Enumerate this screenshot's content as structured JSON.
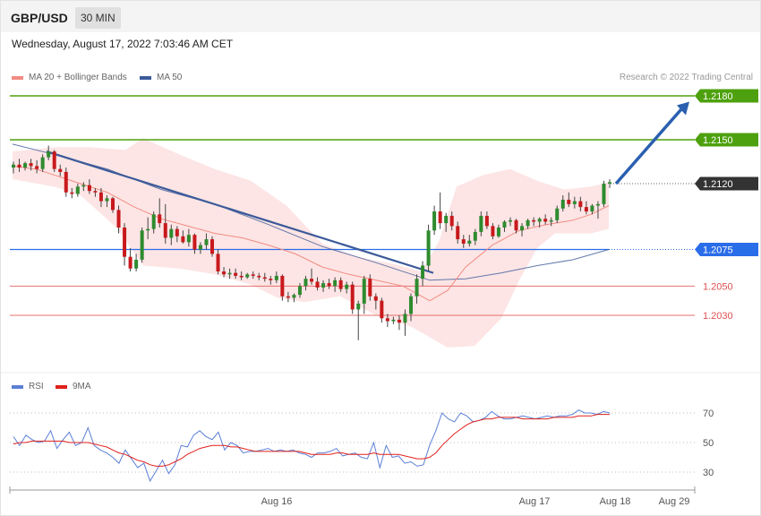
{
  "header": {
    "symbol": "GBP/USD",
    "interval": "30 MIN"
  },
  "timestamp": "Wednesday, August 17, 2022 7:03:46 AM CET",
  "legend": [
    {
      "label": "MA 20 + Bollinger Bands",
      "color": "#f28b82"
    },
    {
      "label": "MA 50",
      "color": "#3b5a99"
    }
  ],
  "credit": "Research © 2022 Trading Central",
  "rsi_legend": [
    {
      "label": "RSI",
      "color": "#5b7fd6"
    },
    {
      "label": "9MA",
      "color": "#e0201b"
    }
  ],
  "chart_data": {
    "type": "candlestick",
    "pair": "GBP/USD",
    "y_range": [
      2.2028,
      1.2197
    ],
    "levels": [
      {
        "value": 1.218,
        "label": "1.2180",
        "color": "#4ea10e",
        "style": "resistance"
      },
      {
        "value": 1.215,
        "label": "1.2150",
        "color": "#4ea10e",
        "style": "resistance"
      },
      {
        "value": 1.212,
        "label": "1.2120",
        "color": "#333333",
        "style": "last"
      },
      {
        "value": 1.2075,
        "label": "1.2075",
        "color": "#2a6de8",
        "style": "pivot"
      },
      {
        "value": 1.205,
        "label": "1.2050",
        "color": "#e05050",
        "style": "support"
      },
      {
        "value": 1.203,
        "label": "1.2030",
        "color": "#e05050",
        "style": "support"
      }
    ],
    "x_labels": [
      "Aug 16",
      "Aug 17",
      "Aug 18",
      "Aug 29"
    ],
    "candles": [
      [
        1.2131,
        1.2135,
        1.2127,
        1.2133
      ],
      [
        1.2133,
        1.2137,
        1.2128,
        1.2131
      ],
      [
        1.2131,
        1.2135,
        1.2129,
        1.2134
      ],
      [
        1.2134,
        1.2137,
        1.2129,
        1.2132
      ],
      [
        1.2132,
        1.2136,
        1.2127,
        1.213
      ],
      [
        1.213,
        1.214,
        1.2128,
        1.2138
      ],
      [
        1.2138,
        1.2146,
        1.2136,
        1.2142
      ],
      [
        1.2142,
        1.2143,
        1.2128,
        1.213
      ],
      [
        1.213,
        1.2133,
        1.2125,
        1.2128
      ],
      [
        1.2128,
        1.2131,
        1.2111,
        1.2114
      ],
      [
        1.2114,
        1.2117,
        1.211,
        1.2113
      ],
      [
        1.2113,
        1.212,
        1.2111,
        1.2118
      ],
      [
        1.2118,
        1.2121,
        1.2115,
        1.2119
      ],
      [
        1.2119,
        1.2123,
        1.2113,
        1.2115
      ],
      [
        1.2115,
        1.2117,
        1.2111,
        1.2114
      ],
      [
        1.2114,
        1.2117,
        1.2104,
        1.2108
      ],
      [
        1.2108,
        1.2112,
        1.2104,
        1.211
      ],
      [
        1.211,
        1.2111,
        1.21,
        1.2102
      ],
      [
        1.2102,
        1.2105,
        1.2086,
        1.209
      ],
      [
        1.209,
        1.2093,
        1.2064,
        1.207
      ],
      [
        1.207,
        1.2076,
        1.206,
        1.2062
      ],
      [
        1.2062,
        1.2072,
        1.206,
        1.2068
      ],
      [
        1.2068,
        1.209,
        1.2066,
        1.2088
      ],
      [
        1.2088,
        1.2097,
        1.2082,
        1.2089
      ],
      [
        1.2089,
        1.2101,
        1.2086,
        1.2099
      ],
      [
        1.2099,
        1.211,
        1.209,
        1.2093
      ],
      [
        1.2093,
        1.2106,
        1.2079,
        1.2083
      ],
      [
        1.2083,
        1.2092,
        1.2078,
        1.2089
      ],
      [
        1.2089,
        1.2091,
        1.208,
        1.2084
      ],
      [
        1.2084,
        1.2088,
        1.2079,
        1.208
      ],
      [
        1.208,
        1.2089,
        1.2077,
        1.2085
      ],
      [
        1.2085,
        1.2086,
        1.2072,
        1.2075
      ],
      [
        1.2075,
        1.208,
        1.2072,
        1.2078
      ],
      [
        1.2078,
        1.2086,
        1.2075,
        1.2082
      ],
      [
        1.2082,
        1.2084,
        1.207,
        1.2072
      ],
      [
        1.2072,
        1.2075,
        1.2058,
        1.206
      ],
      [
        1.206,
        1.2063,
        1.2056,
        1.2058
      ],
      [
        1.2058,
        1.2062,
        1.2055,
        1.2059
      ],
      [
        1.2059,
        1.2062,
        1.2055,
        1.2057
      ],
      [
        1.2057,
        1.206,
        1.2054,
        1.2056
      ],
      [
        1.2056,
        1.2059,
        1.2055,
        1.2058
      ],
      [
        1.2058,
        1.206,
        1.2055,
        1.2057
      ],
      [
        1.2057,
        1.2059,
        1.2054,
        1.2056
      ],
      [
        1.2056,
        1.2059,
        1.2053,
        1.2055
      ],
      [
        1.2055,
        1.2057,
        1.2051,
        1.2054
      ],
      [
        1.2054,
        1.206,
        1.2052,
        1.2057
      ],
      [
        1.2057,
        1.2058,
        1.204,
        1.2043
      ],
      [
        1.2043,
        1.2046,
        1.2039,
        1.2042
      ],
      [
        1.2042,
        1.2045,
        1.2039,
        1.2044
      ],
      [
        1.2044,
        1.2052,
        1.2042,
        1.205
      ],
      [
        1.205,
        1.2057,
        1.2047,
        1.2055
      ],
      [
        1.2055,
        1.2062,
        1.2051,
        1.2053
      ],
      [
        1.2053,
        1.2056,
        1.2047,
        1.2049
      ],
      [
        1.2049,
        1.2054,
        1.2046,
        1.2052
      ],
      [
        1.2052,
        1.2055,
        1.2048,
        1.205
      ],
      [
        1.205,
        1.2056,
        1.2046,
        1.2054
      ],
      [
        1.2054,
        1.2056,
        1.2046,
        1.2048
      ],
      [
        1.2048,
        1.2053,
        1.2045,
        1.2051
      ],
      [
        1.2051,
        1.2053,
        1.2031,
        1.2034
      ],
      [
        1.2034,
        1.204,
        1.2013,
        1.2038
      ],
      [
        1.2038,
        1.2057,
        1.2031,
        1.2055
      ],
      [
        1.2055,
        1.2058,
        1.204,
        1.2043
      ],
      [
        1.2043,
        1.2045,
        1.2034,
        1.204
      ],
      [
        1.204,
        1.2042,
        1.2025,
        1.2028
      ],
      [
        1.2028,
        1.2031,
        1.2022,
        1.2026
      ],
      [
        1.2026,
        1.2029,
        1.2024,
        1.2027
      ],
      [
        1.2027,
        1.203,
        1.202,
        1.2025
      ],
      [
        1.2025,
        1.2034,
        1.2016,
        1.2031
      ],
      [
        1.2031,
        1.2045,
        1.2026,
        1.2043
      ],
      [
        1.2043,
        1.2058,
        1.2038,
        1.2055
      ],
      [
        1.2055,
        1.2067,
        1.205,
        1.2064
      ],
      [
        1.2064,
        1.2092,
        1.206,
        1.2088
      ],
      [
        1.2088,
        1.2105,
        1.2085,
        1.2101
      ],
      [
        1.2101,
        1.2114,
        1.2089,
        1.2093
      ],
      [
        1.2093,
        1.21,
        1.2087,
        1.2098
      ],
      [
        1.2098,
        1.2101,
        1.2088,
        1.2091
      ],
      [
        1.2091,
        1.2094,
        1.2079,
        1.2082
      ],
      [
        1.2082,
        1.2085,
        1.2076,
        1.2079
      ],
      [
        1.2079,
        1.2085,
        1.2077,
        1.2081
      ],
      [
        1.2081,
        1.2089,
        1.2078,
        1.2087
      ],
      [
        1.2087,
        1.2101,
        1.2084,
        1.2098
      ],
      [
        1.2098,
        1.2101,
        1.2089,
        1.2091
      ],
      [
        1.2091,
        1.2093,
        1.2082,
        1.2084
      ],
      [
        1.2084,
        1.2092,
        1.2083,
        1.209
      ],
      [
        1.209,
        1.2095,
        1.2087,
        1.2094
      ],
      [
        1.2094,
        1.2097,
        1.2091,
        1.2095
      ],
      [
        1.2095,
        1.2096,
        1.2086,
        1.2088
      ],
      [
        1.2088,
        1.2093,
        1.2084,
        1.2091
      ],
      [
        1.2091,
        1.2096,
        1.2089,
        1.2095
      ],
      [
        1.2095,
        1.2097,
        1.2091,
        1.2094
      ],
      [
        1.2094,
        1.2097,
        1.209,
        1.2096
      ],
      [
        1.2096,
        1.2099,
        1.2092,
        1.2094
      ],
      [
        1.2094,
        1.2097,
        1.2091,
        1.2095
      ],
      [
        1.2095,
        1.2105,
        1.2093,
        1.2103
      ],
      [
        1.2103,
        1.2112,
        1.2101,
        1.2109
      ],
      [
        1.2109,
        1.2114,
        1.2104,
        1.2106
      ],
      [
        1.2106,
        1.2111,
        1.2103,
        1.2108
      ],
      [
        1.2108,
        1.2111,
        1.2101,
        1.2104
      ],
      [
        1.2104,
        1.2108,
        1.2099,
        1.2101
      ],
      [
        1.2101,
        1.2106,
        1.2099,
        1.2105
      ],
      [
        1.2105,
        1.2108,
        1.2096,
        1.2106
      ],
      [
        1.2106,
        1.2122,
        1.2104,
        1.212
      ],
      [
        1.212,
        1.2123,
        1.2117,
        1.2121
      ]
    ],
    "ma20": [
      [
        14,
        1.2132
      ],
      [
        40,
        1.213
      ],
      [
        60,
        1.2126
      ],
      [
        90,
        1.212
      ],
      [
        120,
        1.2114
      ],
      [
        150,
        1.2104
      ],
      [
        180,
        1.2096
      ],
      [
        210,
        1.2091
      ],
      [
        240,
        1.2086
      ],
      [
        270,
        1.2083
      ],
      [
        300,
        1.2078
      ],
      [
        330,
        1.2072
      ],
      [
        360,
        1.2063
      ],
      [
        390,
        1.2058
      ],
      [
        420,
        1.2054
      ],
      [
        450,
        1.205
      ],
      [
        480,
        1.204
      ],
      [
        500,
        1.2047
      ],
      [
        520,
        1.2063
      ],
      [
        550,
        1.2078
      ],
      [
        580,
        1.2088
      ],
      [
        610,
        1.2092
      ],
      [
        640,
        1.2095
      ],
      [
        660,
        1.2099
      ],
      [
        680,
        1.2105
      ]
    ],
    "ma50": [
      [
        14,
        1.2147
      ],
      [
        60,
        1.214
      ],
      [
        120,
        1.213
      ],
      [
        180,
        1.2116
      ],
      [
        240,
        1.2106
      ],
      [
        300,
        1.2092
      ],
      [
        360,
        1.2077
      ],
      [
        420,
        1.2066
      ],
      [
        480,
        1.2054
      ],
      [
        520,
        1.2055
      ],
      [
        560,
        1.2059
      ],
      [
        600,
        1.2064
      ],
      [
        640,
        1.2068
      ],
      [
        680,
        1.2075
      ]
    ],
    "bb_upper": [
      [
        14,
        1.2142
      ],
      [
        60,
        1.2145
      ],
      [
        100,
        1.2145
      ],
      [
        140,
        1.2143
      ],
      [
        160,
        1.2151
      ],
      [
        200,
        1.214
      ],
      [
        240,
        1.213
      ],
      [
        280,
        1.2122
      ],
      [
        320,
        1.2105
      ],
      [
        360,
        1.2079
      ],
      [
        400,
        1.207
      ],
      [
        440,
        1.2065
      ],
      [
        470,
        1.206
      ],
      [
        490,
        1.208
      ],
      [
        510,
        1.2118
      ],
      [
        540,
        1.2126
      ],
      [
        570,
        1.213
      ],
      [
        600,
        1.2122
      ],
      [
        630,
        1.2116
      ],
      [
        660,
        1.2118
      ],
      [
        680,
        1.2121
      ]
    ],
    "bb_lower": [
      [
        14,
        1.2123
      ],
      [
        60,
        1.2118
      ],
      [
        90,
        1.2112
      ],
      [
        130,
        1.209
      ],
      [
        160,
        1.2064
      ],
      [
        200,
        1.2062
      ],
      [
        240,
        1.2058
      ],
      [
        280,
        1.2051
      ],
      [
        310,
        1.2042
      ],
      [
        340,
        1.2039
      ],
      [
        380,
        1.2043
      ],
      [
        420,
        1.203
      ],
      [
        460,
        1.2022
      ],
      [
        480,
        1.2015
      ],
      [
        500,
        1.2008
      ],
      [
        530,
        1.2009
      ],
      [
        560,
        1.2028
      ],
      [
        580,
        1.2054
      ],
      [
        600,
        1.2076
      ],
      [
        620,
        1.2086
      ],
      [
        660,
        1.2086
      ],
      [
        680,
        1.2089
      ]
    ],
    "trendline": {
      "from": [
        52,
        1.2142
      ],
      "to": [
        484,
        1.2059
      ],
      "color": "#3b5a99"
    },
    "forecast_arrow": {
      "from": [
        688,
        1.212
      ],
      "to": [
        770,
        1.2176
      ],
      "color": "#2a5fb0"
    },
    "rsi": {
      "ticks": [
        70,
        50,
        30
      ],
      "rsi_values": [
        54,
        48,
        55,
        52,
        50,
        51,
        58,
        46,
        52,
        57,
        48,
        50,
        60,
        48,
        45,
        43,
        40,
        36,
        45,
        39,
        33,
        36,
        24,
        31,
        38,
        29,
        35,
        48,
        47,
        55,
        58,
        54,
        52,
        57,
        45,
        50,
        48,
        43,
        44,
        44,
        45,
        46,
        44,
        45,
        44,
        45,
        43,
        42,
        40,
        43,
        43,
        44,
        46,
        41,
        42,
        43,
        40,
        39,
        50,
        33,
        48,
        40,
        41,
        36,
        37,
        34,
        35,
        48,
        58,
        70,
        66,
        64,
        70,
        68,
        64,
        65,
        67,
        71,
        68,
        66,
        66,
        67,
        68,
        67,
        66,
        67,
        68,
        67,
        68,
        68,
        69,
        72,
        70,
        70,
        69,
        71,
        70
      ],
      "ma9_values": [
        49,
        50,
        50,
        51,
        51,
        51,
        51,
        51,
        51,
        50,
        50,
        50,
        50,
        49,
        48,
        47,
        45,
        43,
        42,
        40,
        38,
        37,
        35,
        34,
        34,
        35,
        37,
        39,
        42,
        44,
        46,
        47,
        48,
        48,
        48,
        47,
        47,
        46,
        45,
        44,
        44,
        44,
        44,
        44,
        44,
        44,
        44,
        43,
        42,
        42,
        42,
        42,
        43,
        43,
        42,
        42,
        42,
        42,
        43,
        42,
        42,
        42,
        42,
        41,
        40,
        39,
        39,
        40,
        43,
        48,
        52,
        56,
        59,
        62,
        64,
        65,
        66,
        66,
        67,
        67,
        67,
        67,
        66,
        66,
        66,
        66,
        66,
        67,
        67,
        67,
        67,
        68,
        68,
        68,
        69,
        69,
        69
      ]
    }
  }
}
